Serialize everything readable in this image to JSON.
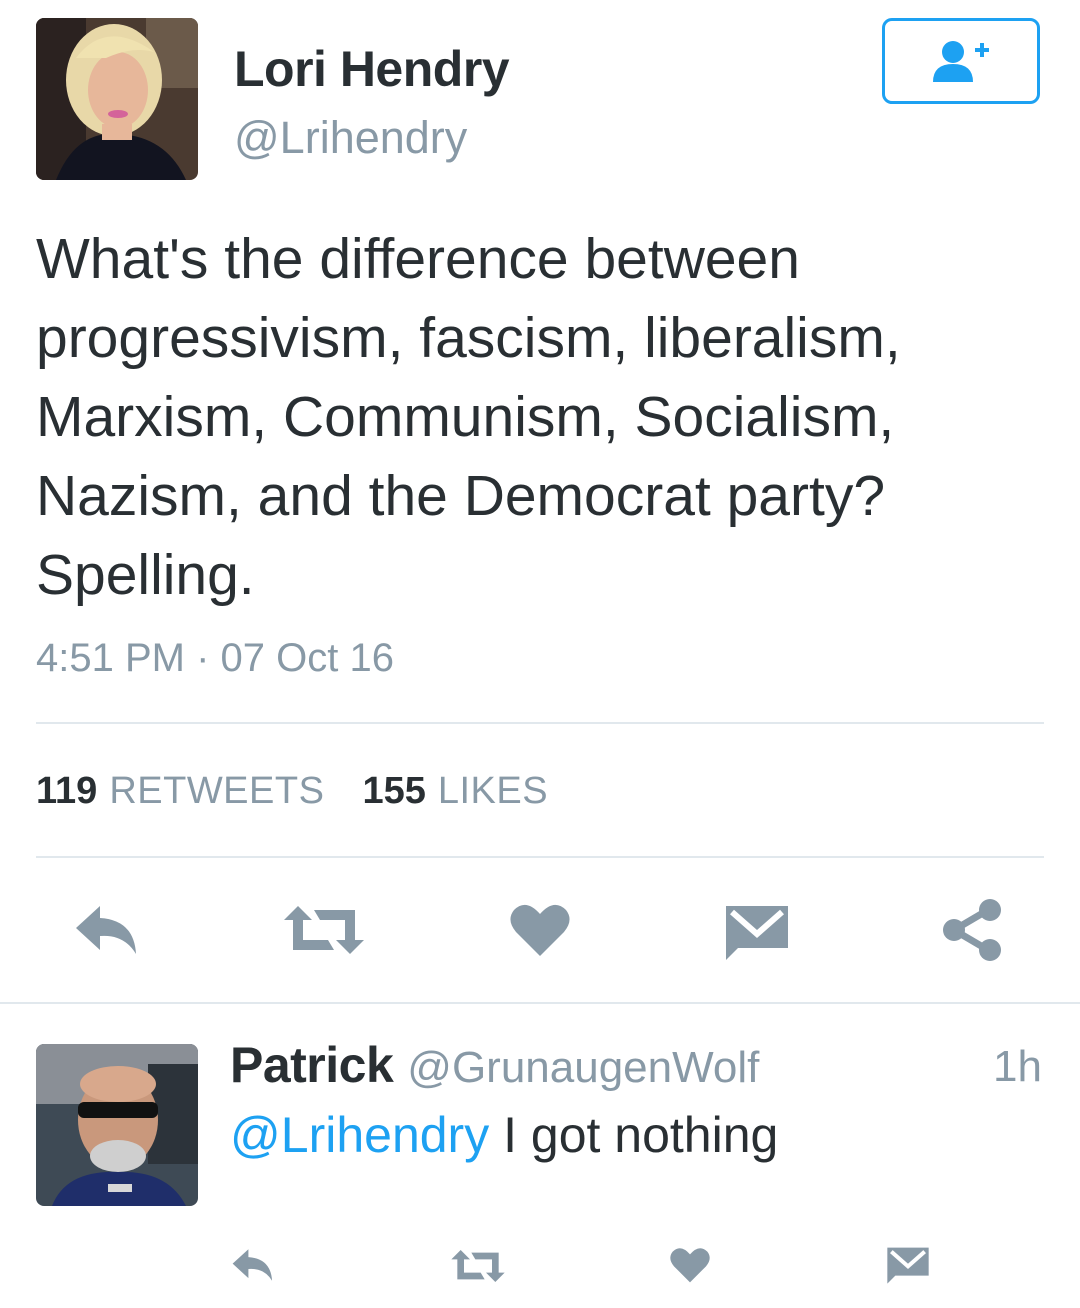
{
  "main_tweet": {
    "author": {
      "name": "Lori Hendry",
      "handle": "@Lrihendry"
    },
    "text_lines": [
      "What's the difference between",
      "progressivism, fascism, liberalism,",
      "Marxism, Communism, Socialism,",
      "Nazism, and the Democrat party?",
      "Spelling."
    ],
    "timestamp": "4:51 PM · 07 Oct 16",
    "stats": {
      "retweets_count": "119",
      "retweets_label": "RETWEETS",
      "likes_count": "155",
      "likes_label": "LIKES"
    },
    "actions": [
      "reply-icon",
      "retweet-icon",
      "heart-icon",
      "direct-message-icon",
      "share-icon"
    ]
  },
  "reply": {
    "author": {
      "name": "Patrick",
      "handle": "@GrunaugenWolf"
    },
    "time": "1h",
    "mention": "@Lrihendry",
    "text": " I got nothing",
    "actions": [
      "reply-icon",
      "retweet-icon",
      "heart-icon",
      "direct-message-icon"
    ]
  },
  "colors": {
    "accent": "#1da1f2",
    "text": "#292f33",
    "muted": "#8899a6",
    "icon": "#8899a6",
    "divider": "#e1e8ed"
  }
}
